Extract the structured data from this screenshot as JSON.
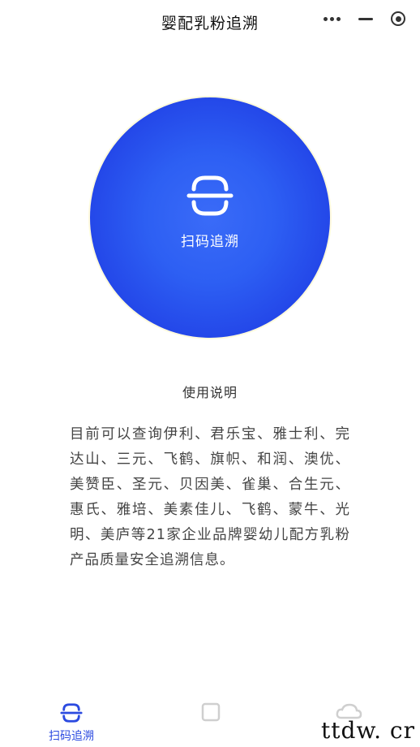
{
  "header": {
    "title": "婴配乳粉追溯"
  },
  "scan": {
    "label": "扫码追溯",
    "accent": "#2d5ff3"
  },
  "usage": {
    "title": "使用说明",
    "text": "目前可以查询伊利、君乐宝、雅士利、完达山、三元、飞鹤、旗帜、和润、澳优、美赞臣、圣元、贝因美、雀巢、合生元、惠氏、雅培、美素佳儿、飞鹤、蒙牛、光明、美庐等21家企业品牌婴幼儿配方乳粉产品质量安全追溯信息。"
  },
  "tabbar": {
    "items": [
      {
        "label": "扫码追溯",
        "icon": "scan-icon",
        "active": true
      },
      {
        "label": "",
        "icon": "square-icon",
        "active": false
      },
      {
        "label": "",
        "icon": "cloud-icon",
        "active": false
      }
    ]
  },
  "watermark": {
    "text": "ttdw. cr"
  }
}
